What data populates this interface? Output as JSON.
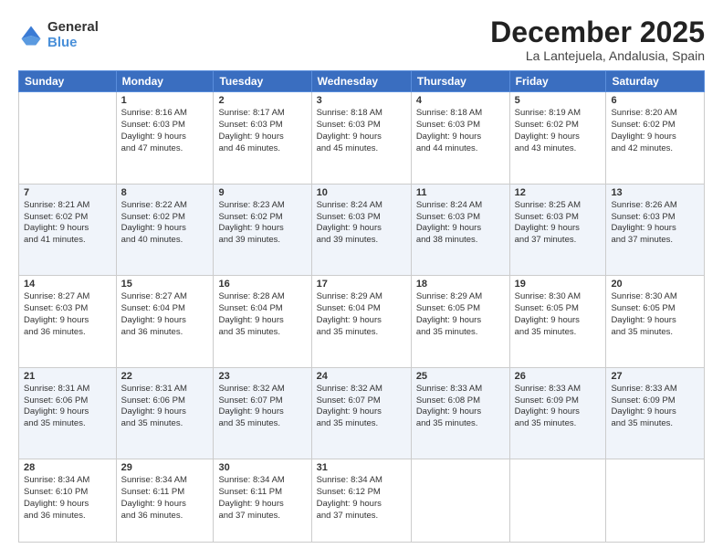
{
  "logo": {
    "general": "General",
    "blue": "Blue"
  },
  "title": "December 2025",
  "location": "La Lantejuela, Andalusia, Spain",
  "weekdays": [
    "Sunday",
    "Monday",
    "Tuesday",
    "Wednesday",
    "Thursday",
    "Friday",
    "Saturday"
  ],
  "weeks": [
    [
      {
        "day": "",
        "info": ""
      },
      {
        "day": "1",
        "info": "Sunrise: 8:16 AM\nSunset: 6:03 PM\nDaylight: 9 hours\nand 47 minutes."
      },
      {
        "day": "2",
        "info": "Sunrise: 8:17 AM\nSunset: 6:03 PM\nDaylight: 9 hours\nand 46 minutes."
      },
      {
        "day": "3",
        "info": "Sunrise: 8:18 AM\nSunset: 6:03 PM\nDaylight: 9 hours\nand 45 minutes."
      },
      {
        "day": "4",
        "info": "Sunrise: 8:18 AM\nSunset: 6:03 PM\nDaylight: 9 hours\nand 44 minutes."
      },
      {
        "day": "5",
        "info": "Sunrise: 8:19 AM\nSunset: 6:02 PM\nDaylight: 9 hours\nand 43 minutes."
      },
      {
        "day": "6",
        "info": "Sunrise: 8:20 AM\nSunset: 6:02 PM\nDaylight: 9 hours\nand 42 minutes."
      }
    ],
    [
      {
        "day": "7",
        "info": "Sunrise: 8:21 AM\nSunset: 6:02 PM\nDaylight: 9 hours\nand 41 minutes."
      },
      {
        "day": "8",
        "info": "Sunrise: 8:22 AM\nSunset: 6:02 PM\nDaylight: 9 hours\nand 40 minutes."
      },
      {
        "day": "9",
        "info": "Sunrise: 8:23 AM\nSunset: 6:02 PM\nDaylight: 9 hours\nand 39 minutes."
      },
      {
        "day": "10",
        "info": "Sunrise: 8:24 AM\nSunset: 6:03 PM\nDaylight: 9 hours\nand 39 minutes."
      },
      {
        "day": "11",
        "info": "Sunrise: 8:24 AM\nSunset: 6:03 PM\nDaylight: 9 hours\nand 38 minutes."
      },
      {
        "day": "12",
        "info": "Sunrise: 8:25 AM\nSunset: 6:03 PM\nDaylight: 9 hours\nand 37 minutes."
      },
      {
        "day": "13",
        "info": "Sunrise: 8:26 AM\nSunset: 6:03 PM\nDaylight: 9 hours\nand 37 minutes."
      }
    ],
    [
      {
        "day": "14",
        "info": "Sunrise: 8:27 AM\nSunset: 6:03 PM\nDaylight: 9 hours\nand 36 minutes."
      },
      {
        "day": "15",
        "info": "Sunrise: 8:27 AM\nSunset: 6:04 PM\nDaylight: 9 hours\nand 36 minutes."
      },
      {
        "day": "16",
        "info": "Sunrise: 8:28 AM\nSunset: 6:04 PM\nDaylight: 9 hours\nand 35 minutes."
      },
      {
        "day": "17",
        "info": "Sunrise: 8:29 AM\nSunset: 6:04 PM\nDaylight: 9 hours\nand 35 minutes."
      },
      {
        "day": "18",
        "info": "Sunrise: 8:29 AM\nSunset: 6:05 PM\nDaylight: 9 hours\nand 35 minutes."
      },
      {
        "day": "19",
        "info": "Sunrise: 8:30 AM\nSunset: 6:05 PM\nDaylight: 9 hours\nand 35 minutes."
      },
      {
        "day": "20",
        "info": "Sunrise: 8:30 AM\nSunset: 6:05 PM\nDaylight: 9 hours\nand 35 minutes."
      }
    ],
    [
      {
        "day": "21",
        "info": "Sunrise: 8:31 AM\nSunset: 6:06 PM\nDaylight: 9 hours\nand 35 minutes."
      },
      {
        "day": "22",
        "info": "Sunrise: 8:31 AM\nSunset: 6:06 PM\nDaylight: 9 hours\nand 35 minutes."
      },
      {
        "day": "23",
        "info": "Sunrise: 8:32 AM\nSunset: 6:07 PM\nDaylight: 9 hours\nand 35 minutes."
      },
      {
        "day": "24",
        "info": "Sunrise: 8:32 AM\nSunset: 6:07 PM\nDaylight: 9 hours\nand 35 minutes."
      },
      {
        "day": "25",
        "info": "Sunrise: 8:33 AM\nSunset: 6:08 PM\nDaylight: 9 hours\nand 35 minutes."
      },
      {
        "day": "26",
        "info": "Sunrise: 8:33 AM\nSunset: 6:09 PM\nDaylight: 9 hours\nand 35 minutes."
      },
      {
        "day": "27",
        "info": "Sunrise: 8:33 AM\nSunset: 6:09 PM\nDaylight: 9 hours\nand 35 minutes."
      }
    ],
    [
      {
        "day": "28",
        "info": "Sunrise: 8:34 AM\nSunset: 6:10 PM\nDaylight: 9 hours\nand 36 minutes."
      },
      {
        "day": "29",
        "info": "Sunrise: 8:34 AM\nSunset: 6:11 PM\nDaylight: 9 hours\nand 36 minutes."
      },
      {
        "day": "30",
        "info": "Sunrise: 8:34 AM\nSunset: 6:11 PM\nDaylight: 9 hours\nand 37 minutes."
      },
      {
        "day": "31",
        "info": "Sunrise: 8:34 AM\nSunset: 6:12 PM\nDaylight: 9 hours\nand 37 minutes."
      },
      {
        "day": "",
        "info": ""
      },
      {
        "day": "",
        "info": ""
      },
      {
        "day": "",
        "info": ""
      }
    ]
  ]
}
